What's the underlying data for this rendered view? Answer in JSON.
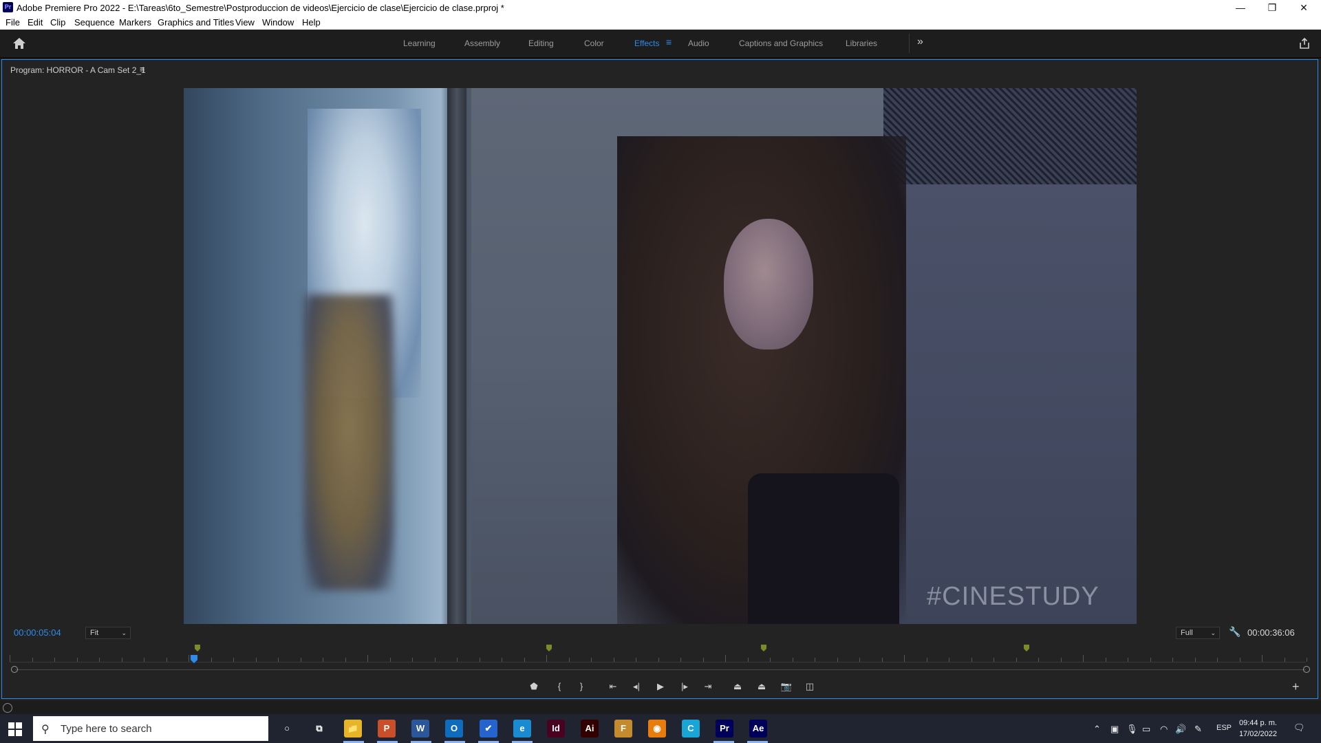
{
  "window": {
    "app_icon": "Pr",
    "title": "Adobe Premiere Pro 2022 - E:\\Tareas\\6to_Semestre\\Postproduccion de videos\\Ejercicio de clase\\Ejercicio de clase.prproj *",
    "minimize": "—",
    "restore": "❐",
    "close": "✕"
  },
  "menu": [
    "File",
    "Edit",
    "Clip",
    "Sequence",
    "Markers",
    "Graphics and Titles",
    "View",
    "Window",
    "Help"
  ],
  "workspaces": {
    "tabs": [
      "Learning",
      "Assembly",
      "Editing",
      "Color",
      "Effects",
      "Audio",
      "Captions and Graphics",
      "Libraries"
    ],
    "active": "Effects",
    "menu_glyph": "≡",
    "more_glyph": "»",
    "icons": {
      "home": "home-icon",
      "share": "share-icon"
    }
  },
  "program": {
    "title": "Program: HORROR - A Cam Set 2_1",
    "menu_glyph": "≡",
    "video_watermark": "#CINESTUDY",
    "timecode_current": "00:00:05:04",
    "timecode_duration": "00:00:36:06",
    "zoom": "Fit",
    "resolution": "Full",
    "playhead_fraction": 0.02
  },
  "transport": [
    {
      "name": "add-marker-button",
      "glyph": "⬟"
    },
    {
      "name": "mark-in-button",
      "glyph": "{"
    },
    {
      "name": "mark-out-button",
      "glyph": "}"
    },
    {
      "name": "go-to-in-button",
      "glyph": "⇤"
    },
    {
      "name": "step-back-button",
      "glyph": "◂|"
    },
    {
      "name": "play-button",
      "glyph": "▶"
    },
    {
      "name": "step-forward-button",
      "glyph": "|▸"
    },
    {
      "name": "go-to-out-button",
      "glyph": "⇥"
    },
    {
      "name": "lift-button",
      "glyph": "⏏"
    },
    {
      "name": "extract-button",
      "glyph": "⏏"
    },
    {
      "name": "export-frame-button",
      "glyph": "📷"
    },
    {
      "name": "comparison-view-button",
      "glyph": "◫"
    }
  ],
  "taskbar": {
    "search_placeholder": "Type here to search",
    "apps": [
      {
        "name": "cortana-icon",
        "label": "○",
        "color": "#1f2430"
      },
      {
        "name": "task-view-icon",
        "label": "⧉",
        "color": "#1f2430"
      },
      {
        "name": "file-explorer-icon",
        "label": "📁",
        "color": "#e7b628"
      },
      {
        "name": "powerpoint-icon",
        "label": "P",
        "color": "#c94f2a"
      },
      {
        "name": "word-icon",
        "label": "W",
        "color": "#2b579a"
      },
      {
        "name": "outlook-icon",
        "label": "O",
        "color": "#0f6cbd"
      },
      {
        "name": "todo-icon",
        "label": "✔",
        "color": "#2564cf"
      },
      {
        "name": "edge-icon",
        "label": "e",
        "color": "#1a8bd1"
      },
      {
        "name": "indesign-icon",
        "label": "Id",
        "color": "#49021f"
      },
      {
        "name": "illustrator-icon",
        "label": "Ai",
        "color": "#330000"
      },
      {
        "name": "firefox-dev-icon",
        "label": "F",
        "color": "#c68a2e"
      },
      {
        "name": "blender-icon",
        "label": "◉",
        "color": "#e87d0d"
      },
      {
        "name": "canva-icon",
        "label": "C",
        "color": "#19a6d6"
      },
      {
        "name": "premiere-icon",
        "label": "Pr",
        "color": "#00005b"
      },
      {
        "name": "after-effects-icon",
        "label": "Ae",
        "color": "#00005b"
      }
    ],
    "language": "ESP",
    "time": "09:44 p. m.",
    "date": "17/02/2022"
  },
  "colors": {
    "accent": "#2d8ceb",
    "panel_bg": "#232323",
    "marker": "#7c8a28"
  }
}
